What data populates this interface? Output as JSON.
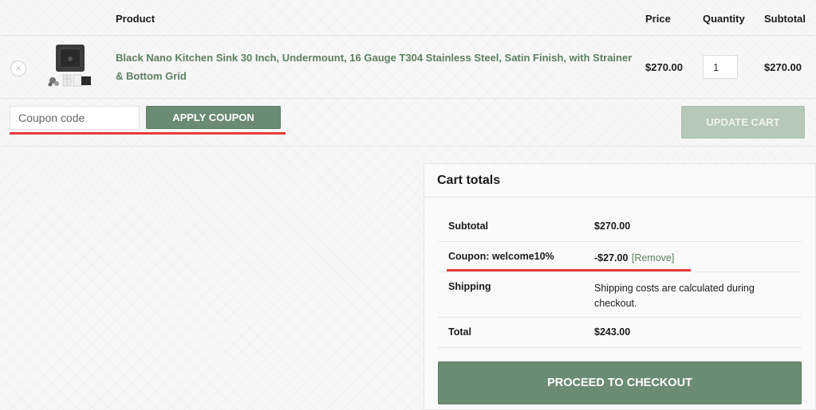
{
  "table": {
    "headers": {
      "product": "Product",
      "price": "Price",
      "quantity": "Quantity",
      "subtotal": "Subtotal"
    },
    "item": {
      "remove_symbol": "×",
      "name_line1": "Black Nano Kitchen Sink 30 Inch, Undermount, 16 Gauge T304 Stainless Steel, Satin Finish, with Strainer",
      "name_line2": "& Bottom Grid",
      "price": "$270.00",
      "quantity": "1",
      "subtotal": "$270.00"
    }
  },
  "actions": {
    "coupon_placeholder": "Coupon code",
    "apply_coupon": "APPLY COUPON",
    "update_cart": "UPDATE CART"
  },
  "cart_totals": {
    "title": "Cart totals",
    "subtotal_label": "Subtotal",
    "subtotal_value": "$270.00",
    "coupon_label": "Coupon: welcome10%",
    "coupon_value": "-$27.00",
    "coupon_remove": "[Remove]",
    "shipping_label": "Shipping",
    "shipping_line1": "Shipping costs are calculated during",
    "shipping_line2": "checkout.",
    "total_label": "Total",
    "total_value": "$243.00",
    "checkout_button": "PROCEED TO CHECKOUT"
  },
  "colors": {
    "accent_green": "#6b8c72",
    "link_green": "#5b7f60",
    "highlight_red": "#e83a3a"
  }
}
